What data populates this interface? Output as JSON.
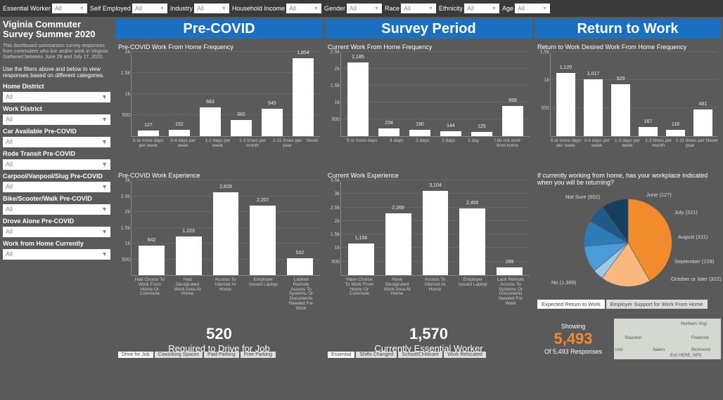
{
  "topFilters": [
    {
      "label": "Essential Worker",
      "value": "All"
    },
    {
      "label": "Self Employed",
      "value": "All"
    },
    {
      "label": "Industry",
      "value": "All"
    },
    {
      "label": "Household Income",
      "value": "All"
    },
    {
      "label": "Gender",
      "value": "All"
    },
    {
      "label": "Race",
      "value": "All"
    },
    {
      "label": "Ethnicity",
      "value": "All"
    },
    {
      "label": "Age",
      "value": "All"
    }
  ],
  "sidebar": {
    "title": "Viginia Commuter Survey Summer 2020",
    "desc": "This dashboard summarizes survey responses from commuters who live and/or work in Virginia. Gathered between June 29 and July 17, 2020.",
    "instr": "Use the filters above and below to view responses based on different categories.",
    "filters": [
      {
        "label": "Home District",
        "value": "All"
      },
      {
        "label": "Work District",
        "value": "All"
      },
      {
        "label": "Car Available Pre-COVID",
        "value": "All"
      },
      {
        "label": "Rode Transit Pre-COVID",
        "value": "All"
      },
      {
        "label": "Carpool/Vanpool/Slug Pre-COVID",
        "value": "All"
      },
      {
        "label": "Bike/Scooter/Walk Pre-COVID",
        "value": "All"
      },
      {
        "label": "Drove Alone Pre-COVID",
        "value": "All"
      },
      {
        "label": "Work from Home Currently",
        "value": "All"
      }
    ]
  },
  "headers": [
    "Pre-COVID",
    "Survey Period",
    "Return to Work"
  ],
  "chart_data": [
    {
      "id": "preFreq",
      "type": "bar",
      "title": "Pre-COVID Work From Home Frequency",
      "categories": [
        "5 or more days per week",
        "3-4 days per week",
        "1-2 days per week",
        "1-3 times per month",
        "1-11 times per year",
        "Never"
      ],
      "values": [
        127,
        152,
        683,
        382,
        645,
        1854
      ],
      "ylim": [
        0,
        2000
      ],
      "yticks": [
        500,
        1000,
        1500,
        2000
      ],
      "yticklabels": [
        "500",
        "1k",
        "1.5k",
        "2k"
      ]
    },
    {
      "id": "curFreq",
      "type": "bar",
      "title": "Current Work From Home Frequency",
      "categories": [
        "5 or more days",
        "4 days",
        "3 days",
        "2 days",
        "1 day",
        "I do not work from home"
      ],
      "values": [
        2185,
        234,
        190,
        144,
        125,
        899
      ],
      "ylim": [
        0,
        2500
      ],
      "yticks": [
        500,
        1000,
        1500,
        2000,
        2500
      ],
      "yticklabels": [
        "500",
        "1k",
        "1.5k",
        "2k",
        "2.5k"
      ]
    },
    {
      "id": "rtwFreq",
      "type": "bar",
      "title": "Return to Work Desired Work From Home Frequency",
      "categories": [
        "5 or more days per week",
        "3-4 days per week",
        "1-2 days per week",
        "1-3 times per month",
        "1-11 times per year",
        "Never"
      ],
      "values": [
        1120,
        1017,
        929,
        167,
        118,
        481
      ],
      "ylim": [
        0,
        1500
      ],
      "yticks": [
        500,
        1000,
        1500
      ],
      "yticklabels": [
        "500",
        "1k",
        "1.5k"
      ]
    },
    {
      "id": "preExp",
      "type": "bar",
      "title": "Pre-COVID Work Experience",
      "categories": [
        "Had Choice To Work From Home Or Commute",
        "Had Designated Work Area At Home",
        "Access To Internet At Home",
        "Employer Issued Laptop",
        "Lacked Remote Access To Systems Or Documents Needed For Work"
      ],
      "values": [
        942,
        1223,
        2628,
        2207,
        532
      ],
      "ylim": [
        0,
        3000
      ],
      "yticks": [
        500,
        1000,
        1500,
        2000,
        2500,
        3000
      ],
      "yticklabels": [
        "500",
        "1k",
        "1.5k",
        "2k",
        "2.5k",
        "3k"
      ]
    },
    {
      "id": "curExp",
      "type": "bar",
      "title": "Current Work Experience",
      "categories": [
        "Have Choice To Work From Home Or Commute",
        "Have Designated Work Area At Home",
        "Access To Internet At Home",
        "Employer Issued Laptop",
        "Lack Remote Access To Systems Or Documents Needed For Work"
      ],
      "values": [
        1158,
        2269,
        3104,
        2455,
        289
      ],
      "ylim": [
        0,
        3500
      ],
      "yticks": [
        500,
        1000,
        1500,
        2000,
        2500,
        3000,
        3500
      ],
      "yticklabels": [
        "500",
        "1k",
        "1.5k",
        "2k",
        "2.5k",
        "3k",
        "3.5k"
      ]
    },
    {
      "id": "pie",
      "type": "pie",
      "title": "If currently working from home, has your workplace indicated when you will be returning?",
      "slices": [
        {
          "label": "No (1,369)",
          "value": 1369,
          "color": "#f18b2c"
        },
        {
          "label": "Not Sure (602)",
          "value": 602,
          "color": "#f8b87e"
        },
        {
          "label": "June (127)",
          "value": 127,
          "color": "#9ec8e8"
        },
        {
          "label": "July (321)",
          "value": 321,
          "color": "#4a9cd8"
        },
        {
          "label": "August (311)",
          "value": 311,
          "color": "#2d7bb8"
        },
        {
          "label": "September (228)",
          "value": 228,
          "color": "#1e5a8a"
        },
        {
          "label": "October or later (322)",
          "value": 322,
          "color": "#163f5f"
        }
      ],
      "tabs": [
        "Expected Return to Work",
        "Employer Support for Work From Home"
      ]
    }
  ],
  "bigNums": [
    {
      "value": "520",
      "label": "Required to Drive for Job",
      "tabs": [
        "Drive for Job",
        "Coworking Spaces",
        "Paid Parking",
        "Free Parking"
      ]
    },
    {
      "value": "1,570",
      "label": "Currently Essential Worker",
      "tabs": [
        "Essential",
        "Shifts Changed",
        "School/Childcare",
        "Work Relocated"
      ]
    }
  ],
  "showing": {
    "label": "Showing",
    "num": "5,493",
    "of": "Of 5,493 Responses"
  },
  "mapLabels": [
    "Northern Virgi",
    "Staunton",
    "Frederick",
    "Richmond",
    "Salem",
    "Esri HERE, NPS",
    "istol"
  ]
}
